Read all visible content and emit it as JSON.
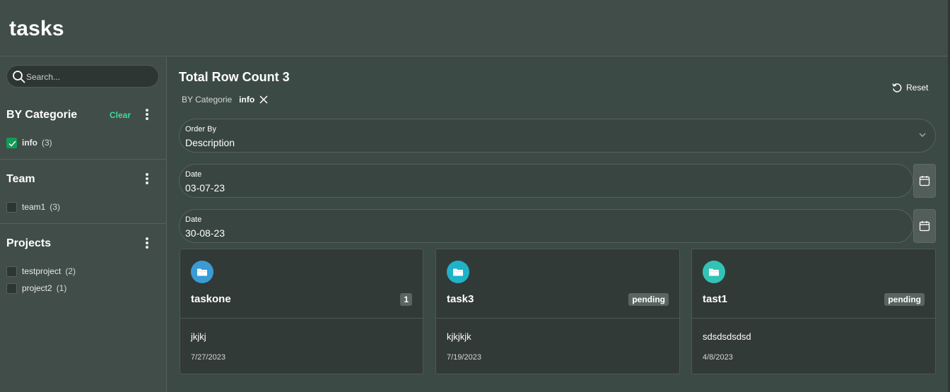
{
  "app": {
    "title": "tasks"
  },
  "sidebar": {
    "search": {
      "placeholder": "Search...",
      "value": ""
    },
    "facets": [
      {
        "title": "BY Categorie",
        "clear_label": "Clear",
        "items": [
          {
            "label": "info",
            "count": "(3)",
            "checked": true
          }
        ]
      },
      {
        "title": "Team",
        "items": [
          {
            "label": "team1",
            "count": "(3)",
            "checked": false
          }
        ]
      },
      {
        "title": "Projects",
        "items": [
          {
            "label": "testproject",
            "count": "(2)",
            "checked": false
          },
          {
            "label": "project2",
            "count": "(1)",
            "checked": false
          }
        ]
      }
    ]
  },
  "main": {
    "row_count": "Total Row Count 3",
    "active_filter": {
      "category": "BY Categorie",
      "value": "info"
    },
    "reset_label": "Reset",
    "order_by": {
      "label": "Order By",
      "value": "Description"
    },
    "date_from": {
      "label": "Date",
      "value": "03-07-23"
    },
    "date_to": {
      "label": "Date",
      "value": "30-08-23"
    },
    "cards": [
      {
        "title": "taskone",
        "badge": "1",
        "description": "jkjkj",
        "date": "7/27/2023",
        "icon": "folder-icon",
        "color": "#3a9bd5"
      },
      {
        "title": "task3",
        "badge": "pending",
        "description": "kjkjkjk",
        "date": "7/19/2023",
        "icon": "folder-icon",
        "color": "#1fb2c9"
      },
      {
        "title": "tast1",
        "badge": "pending",
        "description": "sdsdsdsdsd",
        "date": "4/8/2023",
        "icon": "folder-icon",
        "color": "#33c3b6"
      }
    ]
  },
  "colors": {
    "accent_clear": "#3ddc97",
    "checkbox_checked": "#0f9d58",
    "background": "#3c4a46"
  }
}
